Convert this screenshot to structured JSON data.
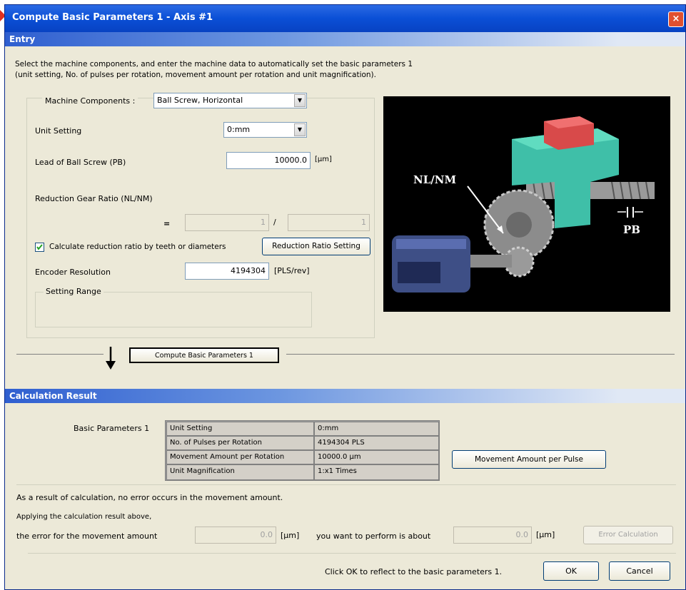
{
  "window": {
    "title": "Compute Basic Parameters 1 - Axis #1",
    "close_icon": "×"
  },
  "entry": {
    "section_title": "Entry",
    "instructions_line1": "Select the machine components, and enter the machine data to automatically set the basic parameters 1",
    "instructions_line2": "(unit setting, No. of pulses per rotation, movement amount per rotation and unit magnification).",
    "machine_components": {
      "label": "Machine Components :",
      "value": "Ball Screw, Horizontal"
    },
    "unit_setting": {
      "label": "Unit Setting",
      "value": "0:mm"
    },
    "lead": {
      "label": "Lead of Ball Screw (PB)",
      "value": "10000.0",
      "unit": "[μm]"
    },
    "reduction_ratio": {
      "label": "Reduction Gear Ratio (NL/NM)",
      "equals": "=",
      "numerator": "1",
      "slash": "/",
      "denominator": "1"
    },
    "calc_checkbox": {
      "label": "Calculate reduction ratio by teeth or diameters",
      "checked": true
    },
    "reduction_setting_button": "Reduction Ratio Setting",
    "encoder": {
      "label": "Encoder Resolution",
      "value": "4194304",
      "unit": "[PLS/rev]"
    },
    "setting_range_label": "Setting Range",
    "diagram": {
      "label_nlnm": "NL/NM",
      "label_pb": "PB"
    }
  },
  "compute_button": "Compute Basic Parameters 1",
  "result": {
    "section_title": "Calculation Result",
    "basic_params_label": "Basic Parameters 1",
    "rows": [
      {
        "name": "Unit Setting",
        "value": "0:mm"
      },
      {
        "name": "No. of Pulses per Rotation",
        "value": "4194304 PLS"
      },
      {
        "name": "Movement Amount per Rotation",
        "value": "10000.0 μm"
      },
      {
        "name": "Unit Magnification",
        "value": "1:x1 Times"
      }
    ],
    "movement_per_pulse_button": "Movement Amount per Pulse",
    "no_error_message": "As a result of calculation, no error occurs in the movement amount.",
    "applying_text": "Applying the calculation result above,",
    "error_label": "the error for the movement amount",
    "error_value": "0.0",
    "error_unit": "[μm]",
    "perform_label": "you want to perform is about",
    "perform_value": "0.0",
    "perform_unit": "[μm]",
    "error_calc_button": "Error Calculation"
  },
  "footer": {
    "message": "Click OK to reflect to the basic parameters 1.",
    "ok": "OK",
    "cancel": "Cancel"
  }
}
